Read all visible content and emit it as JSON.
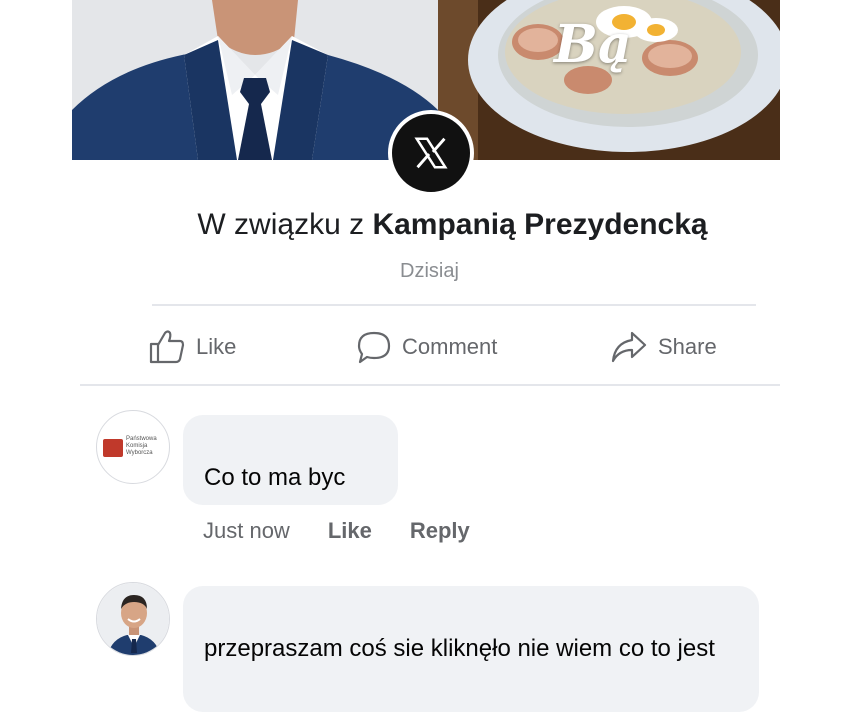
{
  "post": {
    "title_prefix": "W związku z",
    "title_bold": "Kampanią Prezydencką",
    "date": "Dzisiaj",
    "badge_icon": "x-logo-icon",
    "cover_overlay_text": "Bą"
  },
  "actions": {
    "like": "Like",
    "comment": "Comment",
    "share": "Share"
  },
  "comments": [
    {
      "avatar": "pkw-logo",
      "avatar_text": [
        "Państwowa",
        "Komisja",
        "Wyborcza"
      ],
      "text": "Co to ma byc",
      "time": "Just now",
      "like": "Like",
      "reply": "Reply"
    },
    {
      "avatar": "man-in-suit-avatar",
      "text": "przepraszam coś sie kliknęło nie wiem co to jest"
    }
  ],
  "colors": {
    "bubble": "#f0f2f5",
    "secondary_text": "#65676b",
    "primary_text": "#050505",
    "accent_red": "#c0392b"
  }
}
